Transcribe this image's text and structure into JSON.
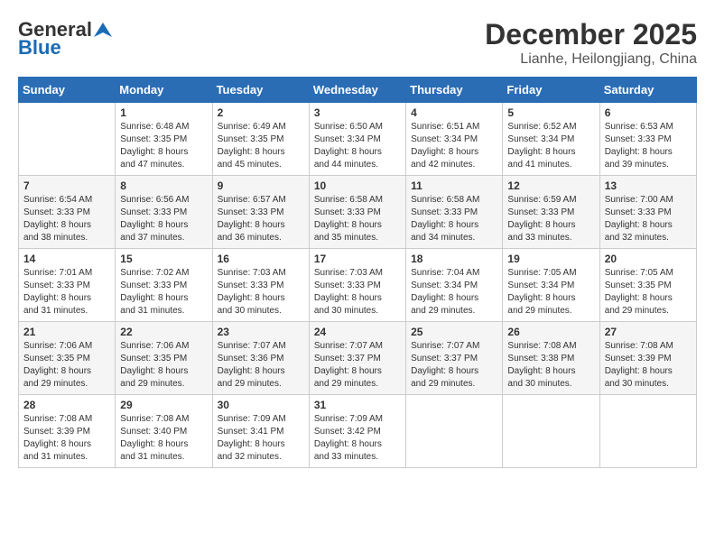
{
  "logo": {
    "general": "General",
    "blue": "Blue"
  },
  "header": {
    "month": "December 2025",
    "location": "Lianhe, Heilongjiang, China"
  },
  "weekdays": [
    "Sunday",
    "Monday",
    "Tuesday",
    "Wednesday",
    "Thursday",
    "Friday",
    "Saturday"
  ],
  "weeks": [
    [
      {
        "day": "",
        "info": ""
      },
      {
        "day": "1",
        "info": "Sunrise: 6:48 AM\nSunset: 3:35 PM\nDaylight: 8 hours\nand 47 minutes."
      },
      {
        "day": "2",
        "info": "Sunrise: 6:49 AM\nSunset: 3:35 PM\nDaylight: 8 hours\nand 45 minutes."
      },
      {
        "day": "3",
        "info": "Sunrise: 6:50 AM\nSunset: 3:34 PM\nDaylight: 8 hours\nand 44 minutes."
      },
      {
        "day": "4",
        "info": "Sunrise: 6:51 AM\nSunset: 3:34 PM\nDaylight: 8 hours\nand 42 minutes."
      },
      {
        "day": "5",
        "info": "Sunrise: 6:52 AM\nSunset: 3:34 PM\nDaylight: 8 hours\nand 41 minutes."
      },
      {
        "day": "6",
        "info": "Sunrise: 6:53 AM\nSunset: 3:33 PM\nDaylight: 8 hours\nand 39 minutes."
      }
    ],
    [
      {
        "day": "7",
        "info": "Sunrise: 6:54 AM\nSunset: 3:33 PM\nDaylight: 8 hours\nand 38 minutes."
      },
      {
        "day": "8",
        "info": "Sunrise: 6:56 AM\nSunset: 3:33 PM\nDaylight: 8 hours\nand 37 minutes."
      },
      {
        "day": "9",
        "info": "Sunrise: 6:57 AM\nSunset: 3:33 PM\nDaylight: 8 hours\nand 36 minutes."
      },
      {
        "day": "10",
        "info": "Sunrise: 6:58 AM\nSunset: 3:33 PM\nDaylight: 8 hours\nand 35 minutes."
      },
      {
        "day": "11",
        "info": "Sunrise: 6:58 AM\nSunset: 3:33 PM\nDaylight: 8 hours\nand 34 minutes."
      },
      {
        "day": "12",
        "info": "Sunrise: 6:59 AM\nSunset: 3:33 PM\nDaylight: 8 hours\nand 33 minutes."
      },
      {
        "day": "13",
        "info": "Sunrise: 7:00 AM\nSunset: 3:33 PM\nDaylight: 8 hours\nand 32 minutes."
      }
    ],
    [
      {
        "day": "14",
        "info": "Sunrise: 7:01 AM\nSunset: 3:33 PM\nDaylight: 8 hours\nand 31 minutes."
      },
      {
        "day": "15",
        "info": "Sunrise: 7:02 AM\nSunset: 3:33 PM\nDaylight: 8 hours\nand 31 minutes."
      },
      {
        "day": "16",
        "info": "Sunrise: 7:03 AM\nSunset: 3:33 PM\nDaylight: 8 hours\nand 30 minutes."
      },
      {
        "day": "17",
        "info": "Sunrise: 7:03 AM\nSunset: 3:33 PM\nDaylight: 8 hours\nand 30 minutes."
      },
      {
        "day": "18",
        "info": "Sunrise: 7:04 AM\nSunset: 3:34 PM\nDaylight: 8 hours\nand 29 minutes."
      },
      {
        "day": "19",
        "info": "Sunrise: 7:05 AM\nSunset: 3:34 PM\nDaylight: 8 hours\nand 29 minutes."
      },
      {
        "day": "20",
        "info": "Sunrise: 7:05 AM\nSunset: 3:35 PM\nDaylight: 8 hours\nand 29 minutes."
      }
    ],
    [
      {
        "day": "21",
        "info": "Sunrise: 7:06 AM\nSunset: 3:35 PM\nDaylight: 8 hours\nand 29 minutes."
      },
      {
        "day": "22",
        "info": "Sunrise: 7:06 AM\nSunset: 3:35 PM\nDaylight: 8 hours\nand 29 minutes."
      },
      {
        "day": "23",
        "info": "Sunrise: 7:07 AM\nSunset: 3:36 PM\nDaylight: 8 hours\nand 29 minutes."
      },
      {
        "day": "24",
        "info": "Sunrise: 7:07 AM\nSunset: 3:37 PM\nDaylight: 8 hours\nand 29 minutes."
      },
      {
        "day": "25",
        "info": "Sunrise: 7:07 AM\nSunset: 3:37 PM\nDaylight: 8 hours\nand 29 minutes."
      },
      {
        "day": "26",
        "info": "Sunrise: 7:08 AM\nSunset: 3:38 PM\nDaylight: 8 hours\nand 30 minutes."
      },
      {
        "day": "27",
        "info": "Sunrise: 7:08 AM\nSunset: 3:39 PM\nDaylight: 8 hours\nand 30 minutes."
      }
    ],
    [
      {
        "day": "28",
        "info": "Sunrise: 7:08 AM\nSunset: 3:39 PM\nDaylight: 8 hours\nand 31 minutes."
      },
      {
        "day": "29",
        "info": "Sunrise: 7:08 AM\nSunset: 3:40 PM\nDaylight: 8 hours\nand 31 minutes."
      },
      {
        "day": "30",
        "info": "Sunrise: 7:09 AM\nSunset: 3:41 PM\nDaylight: 8 hours\nand 32 minutes."
      },
      {
        "day": "31",
        "info": "Sunrise: 7:09 AM\nSunset: 3:42 PM\nDaylight: 8 hours\nand 33 minutes."
      },
      {
        "day": "",
        "info": ""
      },
      {
        "day": "",
        "info": ""
      },
      {
        "day": "",
        "info": ""
      }
    ]
  ]
}
